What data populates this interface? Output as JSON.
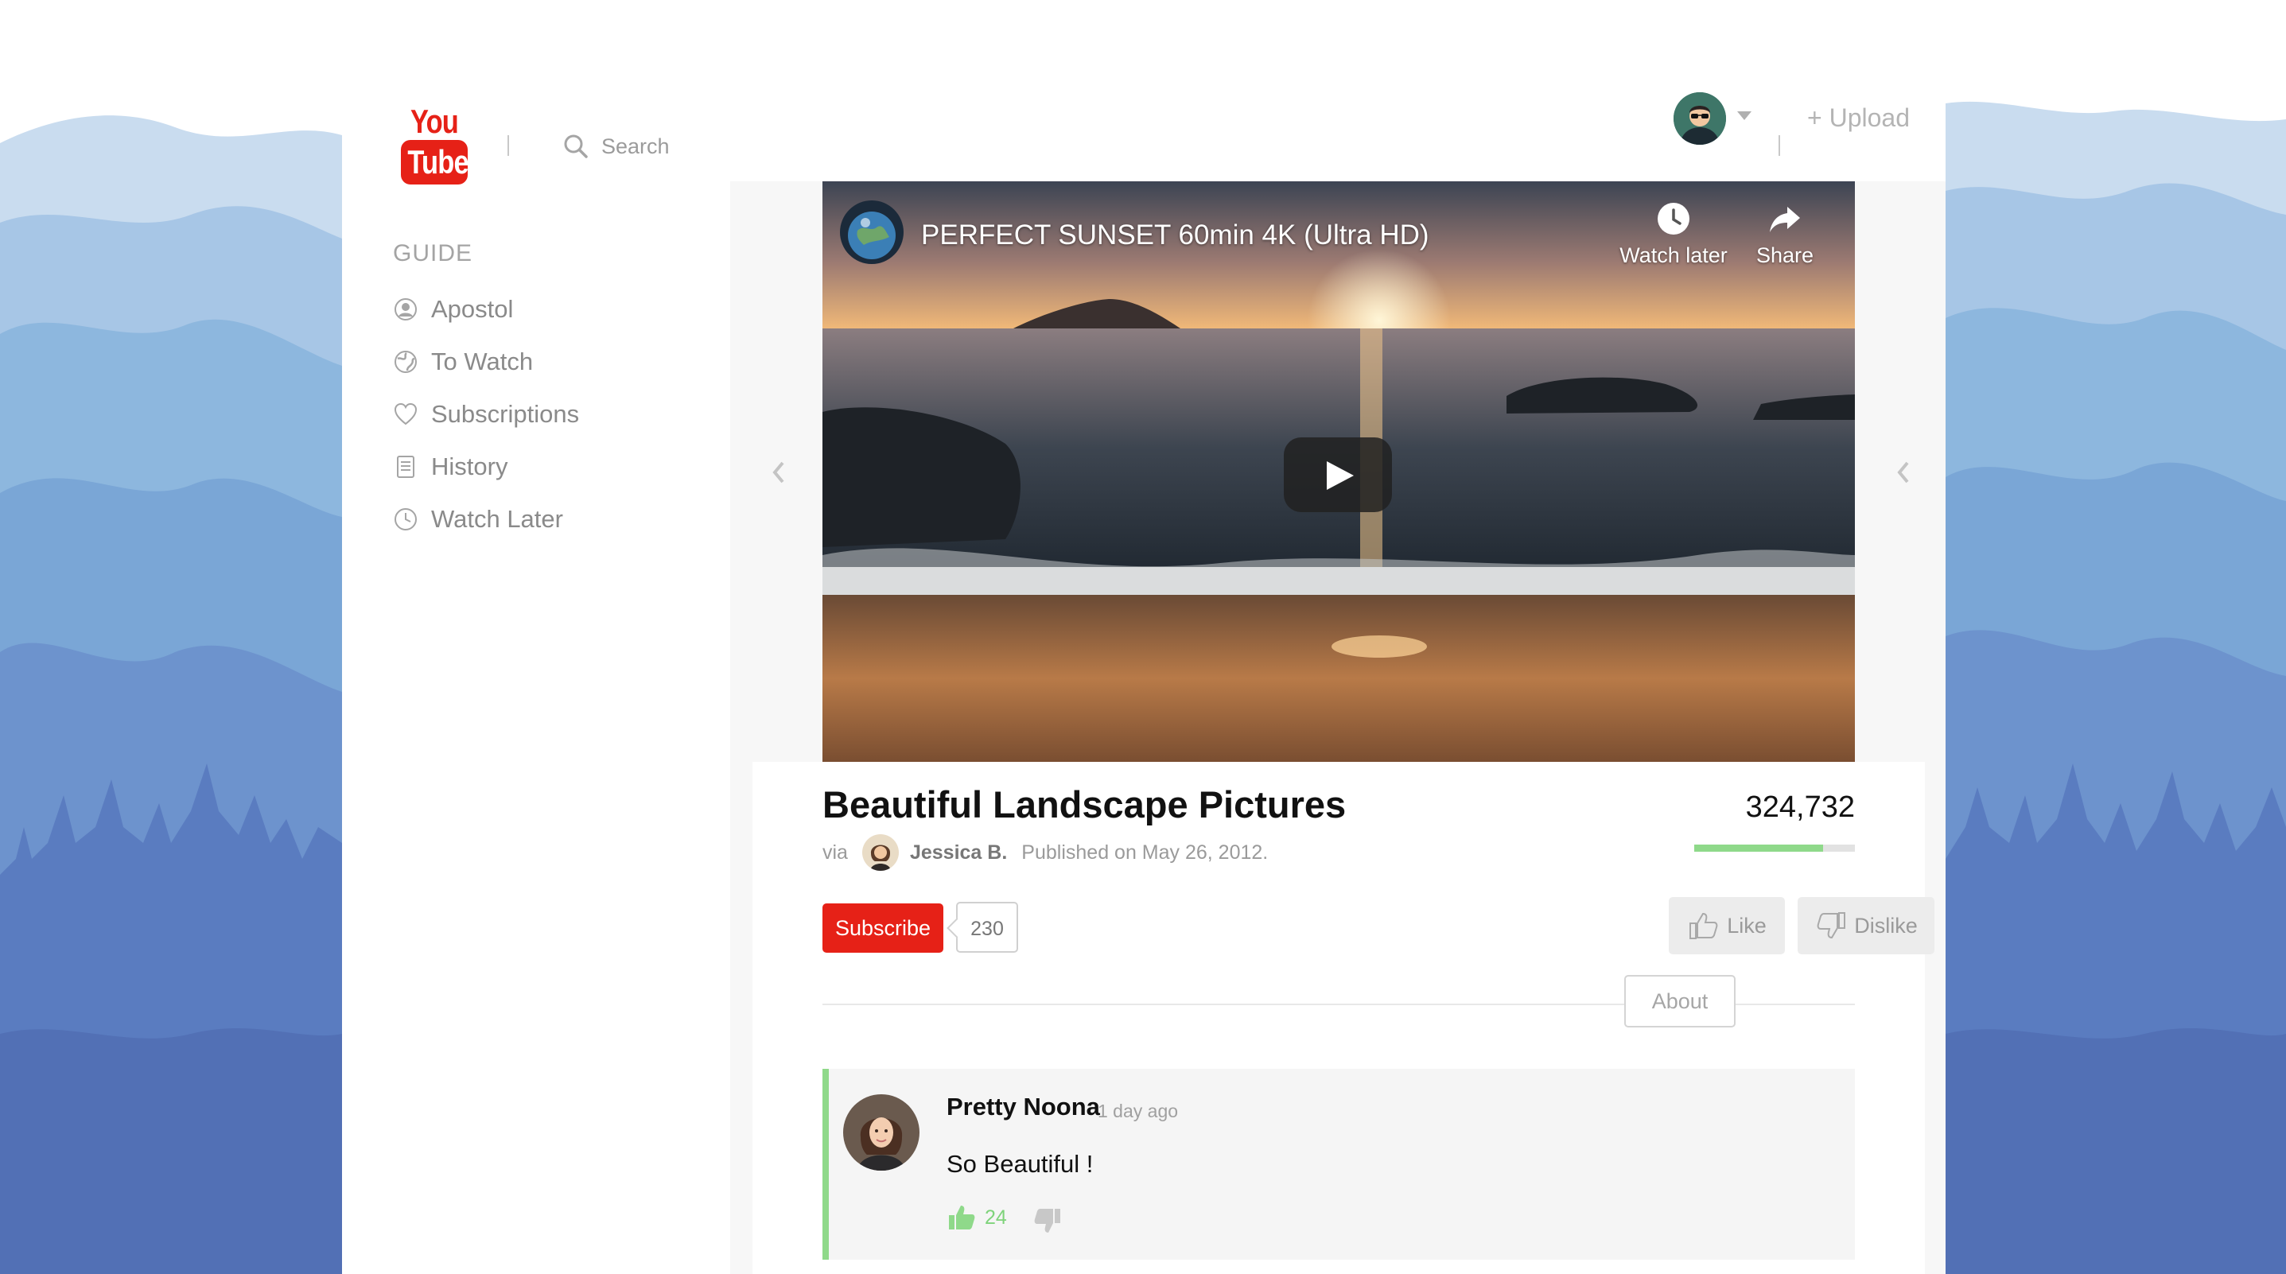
{
  "colors": {
    "brand": "#e62117",
    "accent_green": "#8fd98a",
    "sky_blue": "#b5d2ec",
    "forest_blue": "#5270b5"
  },
  "header": {
    "logo_top": "You",
    "logo_bottom": "Tube",
    "search_placeholder": "Search",
    "upload_label": "+ Upload",
    "account_icon": "user-avatar-icon",
    "account_menu_icon": "chevron-down-icon"
  },
  "sidebar": {
    "title": "GUIDE",
    "items": [
      {
        "label": "Apostol",
        "icon": "user-icon"
      },
      {
        "label": "To Watch",
        "icon": "globe-icon"
      },
      {
        "label": "Subscriptions",
        "icon": "heart-icon"
      },
      {
        "label": "History",
        "icon": "document-icon"
      },
      {
        "label": "Watch Later",
        "icon": "clock-icon"
      }
    ]
  },
  "player": {
    "title": "PERFECT SUNSET 60min 4K (Ultra HD)",
    "watch_later_label": "Watch later",
    "share_label": "Share"
  },
  "video": {
    "title": "Beautiful Landscape Pictures",
    "via_label": "via",
    "author": "Jessica B.",
    "published": "Published on May 26, 2012.",
    "views": "324,732",
    "like_ratio": 0.8,
    "subscribe_label": "Subscribe",
    "subscriber_count": "230",
    "like_label": "Like",
    "dislike_label": "Dislike",
    "about_label": "About"
  },
  "comments": [
    {
      "author": "Pretty Noona",
      "time": "1 day ago",
      "text": "So Beautiful !",
      "likes": "24"
    }
  ]
}
